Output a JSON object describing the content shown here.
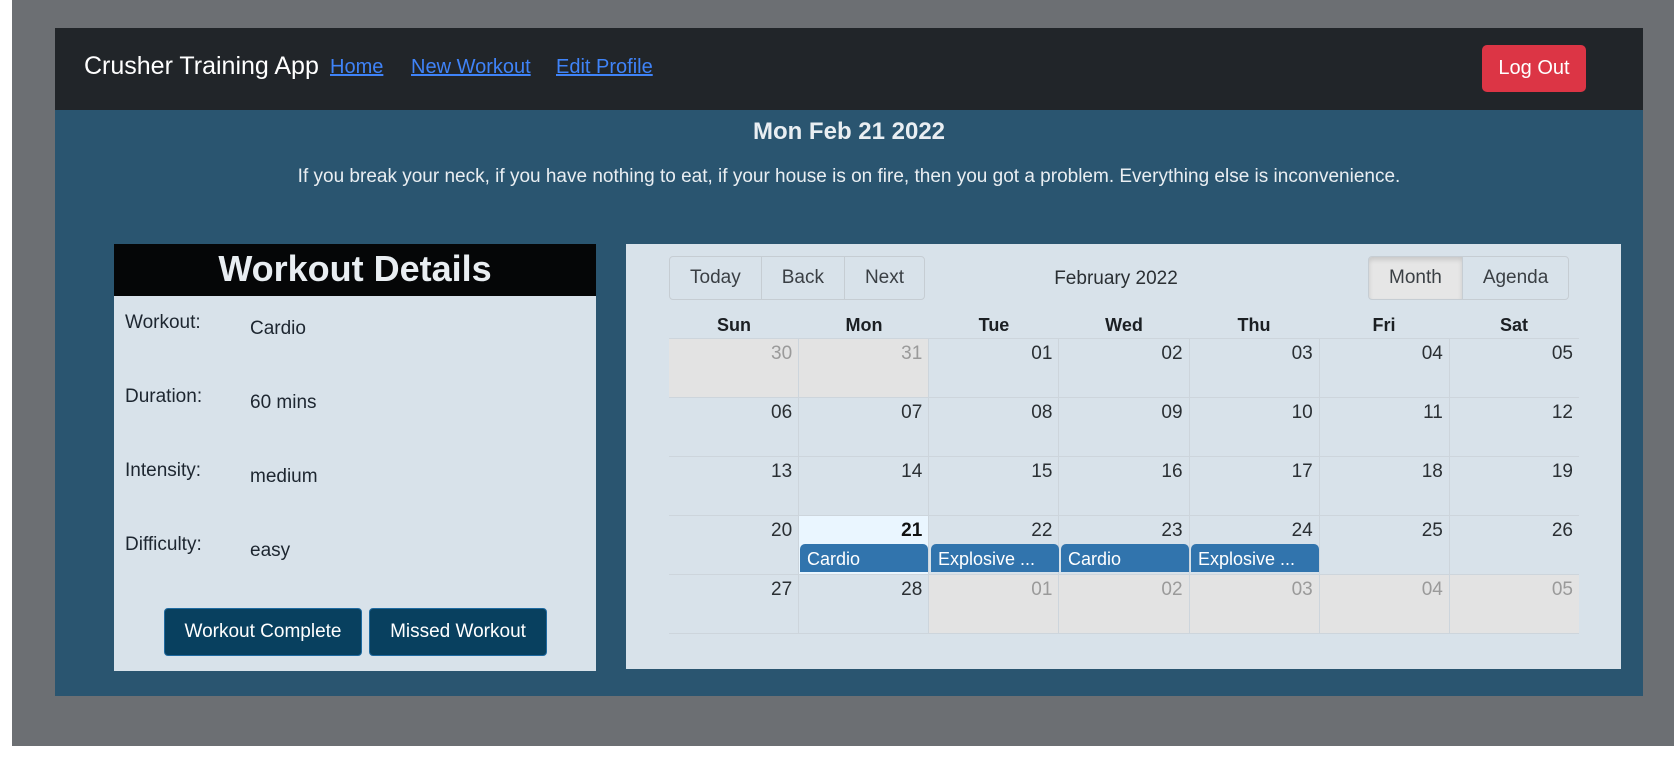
{
  "nav": {
    "brand": "Crusher Training App",
    "links": [
      "Home",
      "New Workout",
      "Edit Profile"
    ],
    "logout": "Log Out"
  },
  "header": {
    "date": "Mon Feb 21 2022",
    "quote": "If you break your neck, if you have nothing to eat, if your house is on fire, then you got a problem. Everything else is inconvenience."
  },
  "details": {
    "title": "Workout Details",
    "rows": [
      {
        "label": "Workout:",
        "value": "Cardio"
      },
      {
        "label": "Duration:",
        "value": "60 mins"
      },
      {
        "label": "Intensity:",
        "value": "medium"
      },
      {
        "label": "Difficulty:",
        "value": "easy"
      }
    ],
    "complete_button": "Workout Complete",
    "missed_button": "Missed Workout"
  },
  "calendar": {
    "nav_buttons": [
      "Today",
      "Back",
      "Next"
    ],
    "label": "February 2022",
    "view_buttons": [
      "Month",
      "Agenda"
    ],
    "active_view": "Month",
    "weekdays": [
      "Sun",
      "Mon",
      "Tue",
      "Wed",
      "Thu",
      "Fri",
      "Sat"
    ],
    "weeks": [
      [
        "30",
        "31",
        "01",
        "02",
        "03",
        "04",
        "05"
      ],
      [
        "06",
        "07",
        "08",
        "09",
        "10",
        "11",
        "12"
      ],
      [
        "13",
        "14",
        "15",
        "16",
        "17",
        "18",
        "19"
      ],
      [
        "20",
        "21",
        "22",
        "23",
        "24",
        "25",
        "26"
      ],
      [
        "27",
        "28",
        "01",
        "02",
        "03",
        "04",
        "05"
      ]
    ],
    "events": [
      "Cardio",
      "Explosive ...",
      "Cardio",
      "Explosive ..."
    ]
  },
  "colors": {
    "navbar": "#212529",
    "main_bg": "#2a5570",
    "logout": "#dc3545",
    "event": "#3174ad",
    "details_button": "#08405f"
  }
}
